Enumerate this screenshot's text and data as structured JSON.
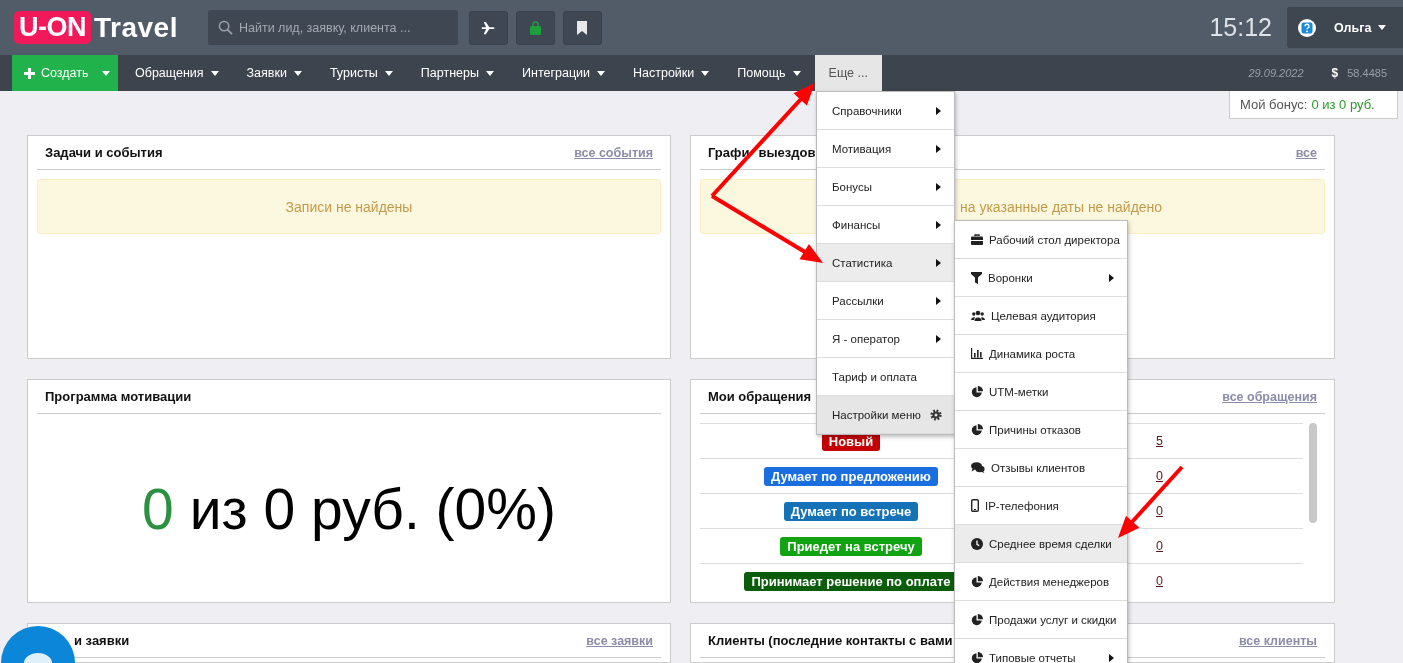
{
  "header": {
    "logo": {
      "brand": "U-ON",
      "product": "Travel"
    },
    "search": {
      "placeholder": "Найти лид, заявку, клиента ..."
    },
    "time": "15:12",
    "user": {
      "name": "Ольга"
    }
  },
  "nav": {
    "create_button": "Создать",
    "items": [
      {
        "label": "Обращения",
        "selected": false,
        "has_caret": true
      },
      {
        "label": "Заявки",
        "selected": false,
        "has_caret": true
      },
      {
        "label": "Туристы",
        "selected": false,
        "has_caret": true
      },
      {
        "label": "Партнеры",
        "selected": false,
        "has_caret": true
      },
      {
        "label": "Интеграции",
        "selected": false,
        "has_caret": true
      },
      {
        "label": "Настройки",
        "selected": false,
        "has_caret": true
      },
      {
        "label": "Помощь",
        "selected": false,
        "has_caret": true
      },
      {
        "label": "Еще ...",
        "selected": true,
        "has_caret": false
      }
    ],
    "date": "29.09.2022",
    "currency": {
      "symbol": "$",
      "rate": "58.4485"
    }
  },
  "bonus": {
    "label": "Мой бонус:",
    "value": "0 из 0 руб."
  },
  "cards": [
    {
      "kind": "alert",
      "title": "Задачи и события",
      "link": "все события",
      "alert": "Записи не найдены"
    },
    {
      "kind": "alert",
      "title": "Графи",
      "title_rest": "выездов",
      "link": "все",
      "alert": "на указанные даты не найдено",
      "alert_covered": true
    },
    {
      "kind": "motivation",
      "title": "Программа мотивации",
      "achieved": "0",
      "rest": "из 0 руб. (0%)"
    },
    {
      "kind": "table",
      "title": "Мои обращения",
      "link": "все обращения",
      "rows": [
        {
          "status": "Новый",
          "color": "#c40000",
          "count": "5"
        },
        {
          "status": "Думает по предложению",
          "color": "#1a6fe0",
          "count": "0"
        },
        {
          "status": "Думает по встрече",
          "color": "#1572b6",
          "count": "0"
        },
        {
          "status": "Приедет на встречу",
          "color": "#12a312",
          "count": "0"
        },
        {
          "status": "Принимает решение по оплате",
          "color": "#0b5c0b",
          "count": "0"
        }
      ]
    },
    {
      "kind": "empty",
      "title": "и заявки",
      "link": "все заявки",
      "title_covered": true
    },
    {
      "kind": "empty",
      "title": "Клиенты (последние контакты с вами",
      "link": "все клиенты"
    }
  ],
  "more_menu": {
    "items": [
      {
        "label": "Справочники",
        "kind": "submenu",
        "selected": false
      },
      {
        "label": "Мотивация",
        "kind": "submenu",
        "selected": false
      },
      {
        "label": "Бонусы",
        "kind": "submenu",
        "selected": false
      },
      {
        "label": "Финансы",
        "kind": "submenu",
        "selected": false
      },
      {
        "label": "Статистика",
        "kind": "submenu",
        "selected": true
      },
      {
        "label": "Рассылки",
        "kind": "submenu",
        "selected": false
      },
      {
        "label": "Я - оператор",
        "kind": "submenu",
        "selected": false
      },
      {
        "label": "Тариф и оплата",
        "kind": "link",
        "selected": false
      },
      {
        "label": "Настройки меню",
        "kind": "settings",
        "selected": false
      }
    ]
  },
  "statistics_submenu": {
    "items": [
      {
        "label": "Рабочий стол директора",
        "has_submenu": false,
        "selected": false
      },
      {
        "label": "Воронки",
        "has_submenu": true,
        "selected": false
      },
      {
        "label": "Целевая аудитория",
        "has_submenu": false,
        "selected": false
      },
      {
        "label": "Динамика роста",
        "has_submenu": false,
        "selected": false
      },
      {
        "label": "UTM-метки",
        "has_submenu": false,
        "selected": false
      },
      {
        "label": "Причины отказов",
        "has_submenu": false,
        "selected": false
      },
      {
        "label": "Отзывы клиентов",
        "has_submenu": false,
        "selected": false
      },
      {
        "label": "IP-телефония",
        "has_submenu": false,
        "selected": false
      },
      {
        "label": "Среднее время сделки",
        "has_submenu": false,
        "selected": true
      },
      {
        "label": "Действия менеджеров",
        "has_submenu": false,
        "selected": false
      },
      {
        "label": "Продажи услуг и скидки",
        "has_submenu": false,
        "selected": false
      },
      {
        "label": "Типовые отчеты",
        "has_submenu": true,
        "selected": false
      }
    ]
  }
}
